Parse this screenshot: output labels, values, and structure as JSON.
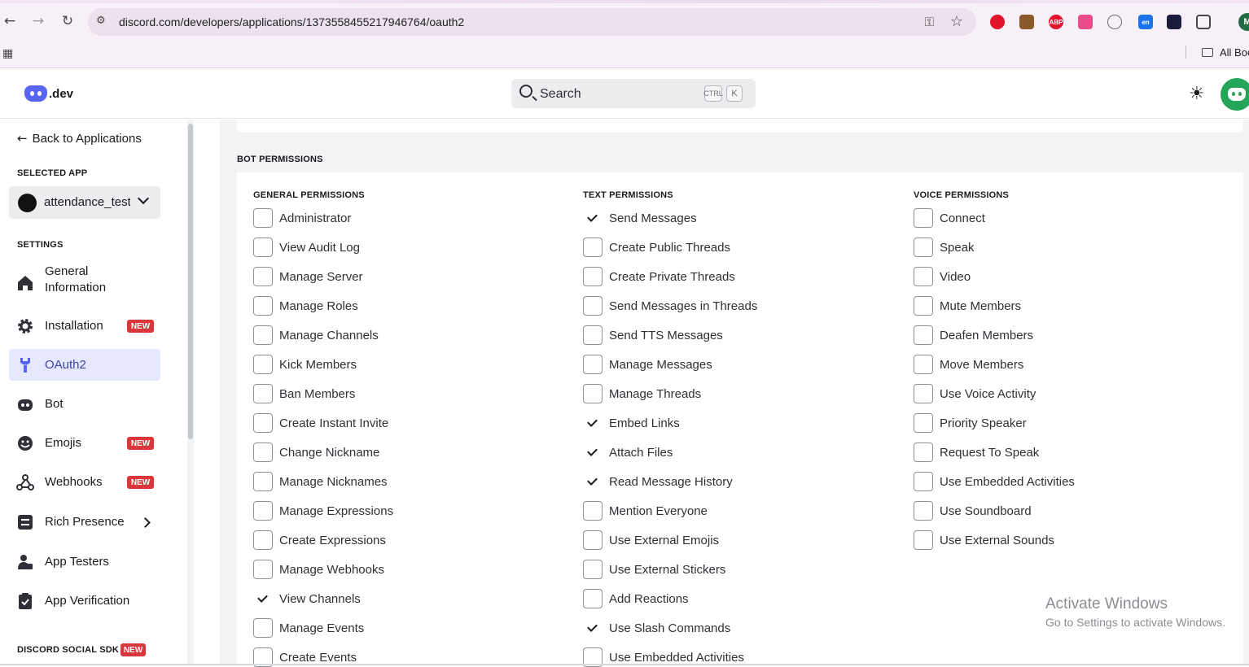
{
  "browser": {
    "url": "discord.com/developers/applications/1373558455217946764/oauth2",
    "profile_initial": "M",
    "bookmarks_label": "All Boo",
    "extensions": [
      {
        "name": "rec-extension-icon",
        "label": "",
        "color": "#e3132b"
      },
      {
        "name": "cookie-extension-icon",
        "label": "",
        "color": "#8b5a2b"
      },
      {
        "name": "adblock-extension-icon",
        "label": "ABP",
        "color": "#e3132b"
      },
      {
        "name": "translate-extension-icon",
        "label": "",
        "color": "#e84d8a"
      },
      {
        "name": "download-extension-icon",
        "label": "",
        "color": "#6d6f78"
      },
      {
        "name": "lang-extension-icon",
        "label": "en",
        "color": "#1a73e8"
      },
      {
        "name": "dark-extension-icon",
        "label": "",
        "color": "#1a1b3a"
      },
      {
        "name": "puzzle-extension-icon",
        "label": "",
        "color": "#474747"
      }
    ]
  },
  "header": {
    "logo_text": ".dev",
    "search_placeholder": "Search",
    "shortcut_ctrl": "CTRL",
    "shortcut_key": "K"
  },
  "sidebar": {
    "back_label": "Back to Applications",
    "selected_app_heading": "SELECTED APP",
    "selected_app_name": "attendance_test",
    "settings_heading": "SETTINGS",
    "new_badge": "NEW",
    "items": [
      {
        "label": "General Information",
        "icon": "home-icon"
      },
      {
        "label": "Installation",
        "icon": "gear-icon",
        "new": true
      },
      {
        "label": "OAuth2",
        "icon": "wrench-icon",
        "active": true
      },
      {
        "label": "Bot",
        "icon": "bot-icon"
      },
      {
        "label": "Emojis",
        "icon": "emoji-icon",
        "new": true
      },
      {
        "label": "Webhooks",
        "icon": "webhook-icon",
        "new": true
      },
      {
        "label": "Rich Presence",
        "icon": "rich-presence-icon"
      },
      {
        "label": "App Testers",
        "icon": "app-testers-icon"
      },
      {
        "label": "App Verification",
        "icon": "verification-icon"
      }
    ],
    "social_sdk_heading": "DISCORD SOCIAL SDK"
  },
  "main": {
    "bot_permissions_title": "BOT PERMISSIONS",
    "columns": [
      {
        "heading": "GENERAL PERMISSIONS",
        "items": [
          {
            "label": "Administrator",
            "checked": false
          },
          {
            "label": "View Audit Log",
            "checked": false
          },
          {
            "label": "Manage Server",
            "checked": false
          },
          {
            "label": "Manage Roles",
            "checked": false
          },
          {
            "label": "Manage Channels",
            "checked": false
          },
          {
            "label": "Kick Members",
            "checked": false
          },
          {
            "label": "Ban Members",
            "checked": false
          },
          {
            "label": "Create Instant Invite",
            "checked": false
          },
          {
            "label": "Change Nickname",
            "checked": false
          },
          {
            "label": "Manage Nicknames",
            "checked": false
          },
          {
            "label": "Manage Expressions",
            "checked": false
          },
          {
            "label": "Create Expressions",
            "checked": false
          },
          {
            "label": "Manage Webhooks",
            "checked": false
          },
          {
            "label": "View Channels",
            "checked": true
          },
          {
            "label": "Manage Events",
            "checked": false
          },
          {
            "label": "Create Events",
            "checked": false
          }
        ]
      },
      {
        "heading": "TEXT PERMISSIONS",
        "items": [
          {
            "label": "Send Messages",
            "checked": true
          },
          {
            "label": "Create Public Threads",
            "checked": false
          },
          {
            "label": "Create Private Threads",
            "checked": false
          },
          {
            "label": "Send Messages in Threads",
            "checked": false
          },
          {
            "label": "Send TTS Messages",
            "checked": false
          },
          {
            "label": "Manage Messages",
            "checked": false
          },
          {
            "label": "Manage Threads",
            "checked": false
          },
          {
            "label": "Embed Links",
            "checked": true
          },
          {
            "label": "Attach Files",
            "checked": true
          },
          {
            "label": "Read Message History",
            "checked": true
          },
          {
            "label": "Mention Everyone",
            "checked": false
          },
          {
            "label": "Use External Emojis",
            "checked": false
          },
          {
            "label": "Use External Stickers",
            "checked": false
          },
          {
            "label": "Add Reactions",
            "checked": false
          },
          {
            "label": "Use Slash Commands",
            "checked": true
          },
          {
            "label": "Use Embedded Activities",
            "checked": false
          }
        ]
      },
      {
        "heading": "VOICE PERMISSIONS",
        "items": [
          {
            "label": "Connect",
            "checked": false
          },
          {
            "label": "Speak",
            "checked": false
          },
          {
            "label": "Video",
            "checked": false
          },
          {
            "label": "Mute Members",
            "checked": false
          },
          {
            "label": "Deafen Members",
            "checked": false
          },
          {
            "label": "Move Members",
            "checked": false
          },
          {
            "label": "Use Voice Activity",
            "checked": false
          },
          {
            "label": "Priority Speaker",
            "checked": false
          },
          {
            "label": "Request To Speak",
            "checked": false
          },
          {
            "label": "Use Embedded Activities",
            "checked": false
          },
          {
            "label": "Use Soundboard",
            "checked": false
          },
          {
            "label": "Use External Sounds",
            "checked": false
          }
        ]
      }
    ]
  },
  "watermark": {
    "line1": "Activate Windows",
    "line2": "Go to Settings to activate Windows."
  }
}
